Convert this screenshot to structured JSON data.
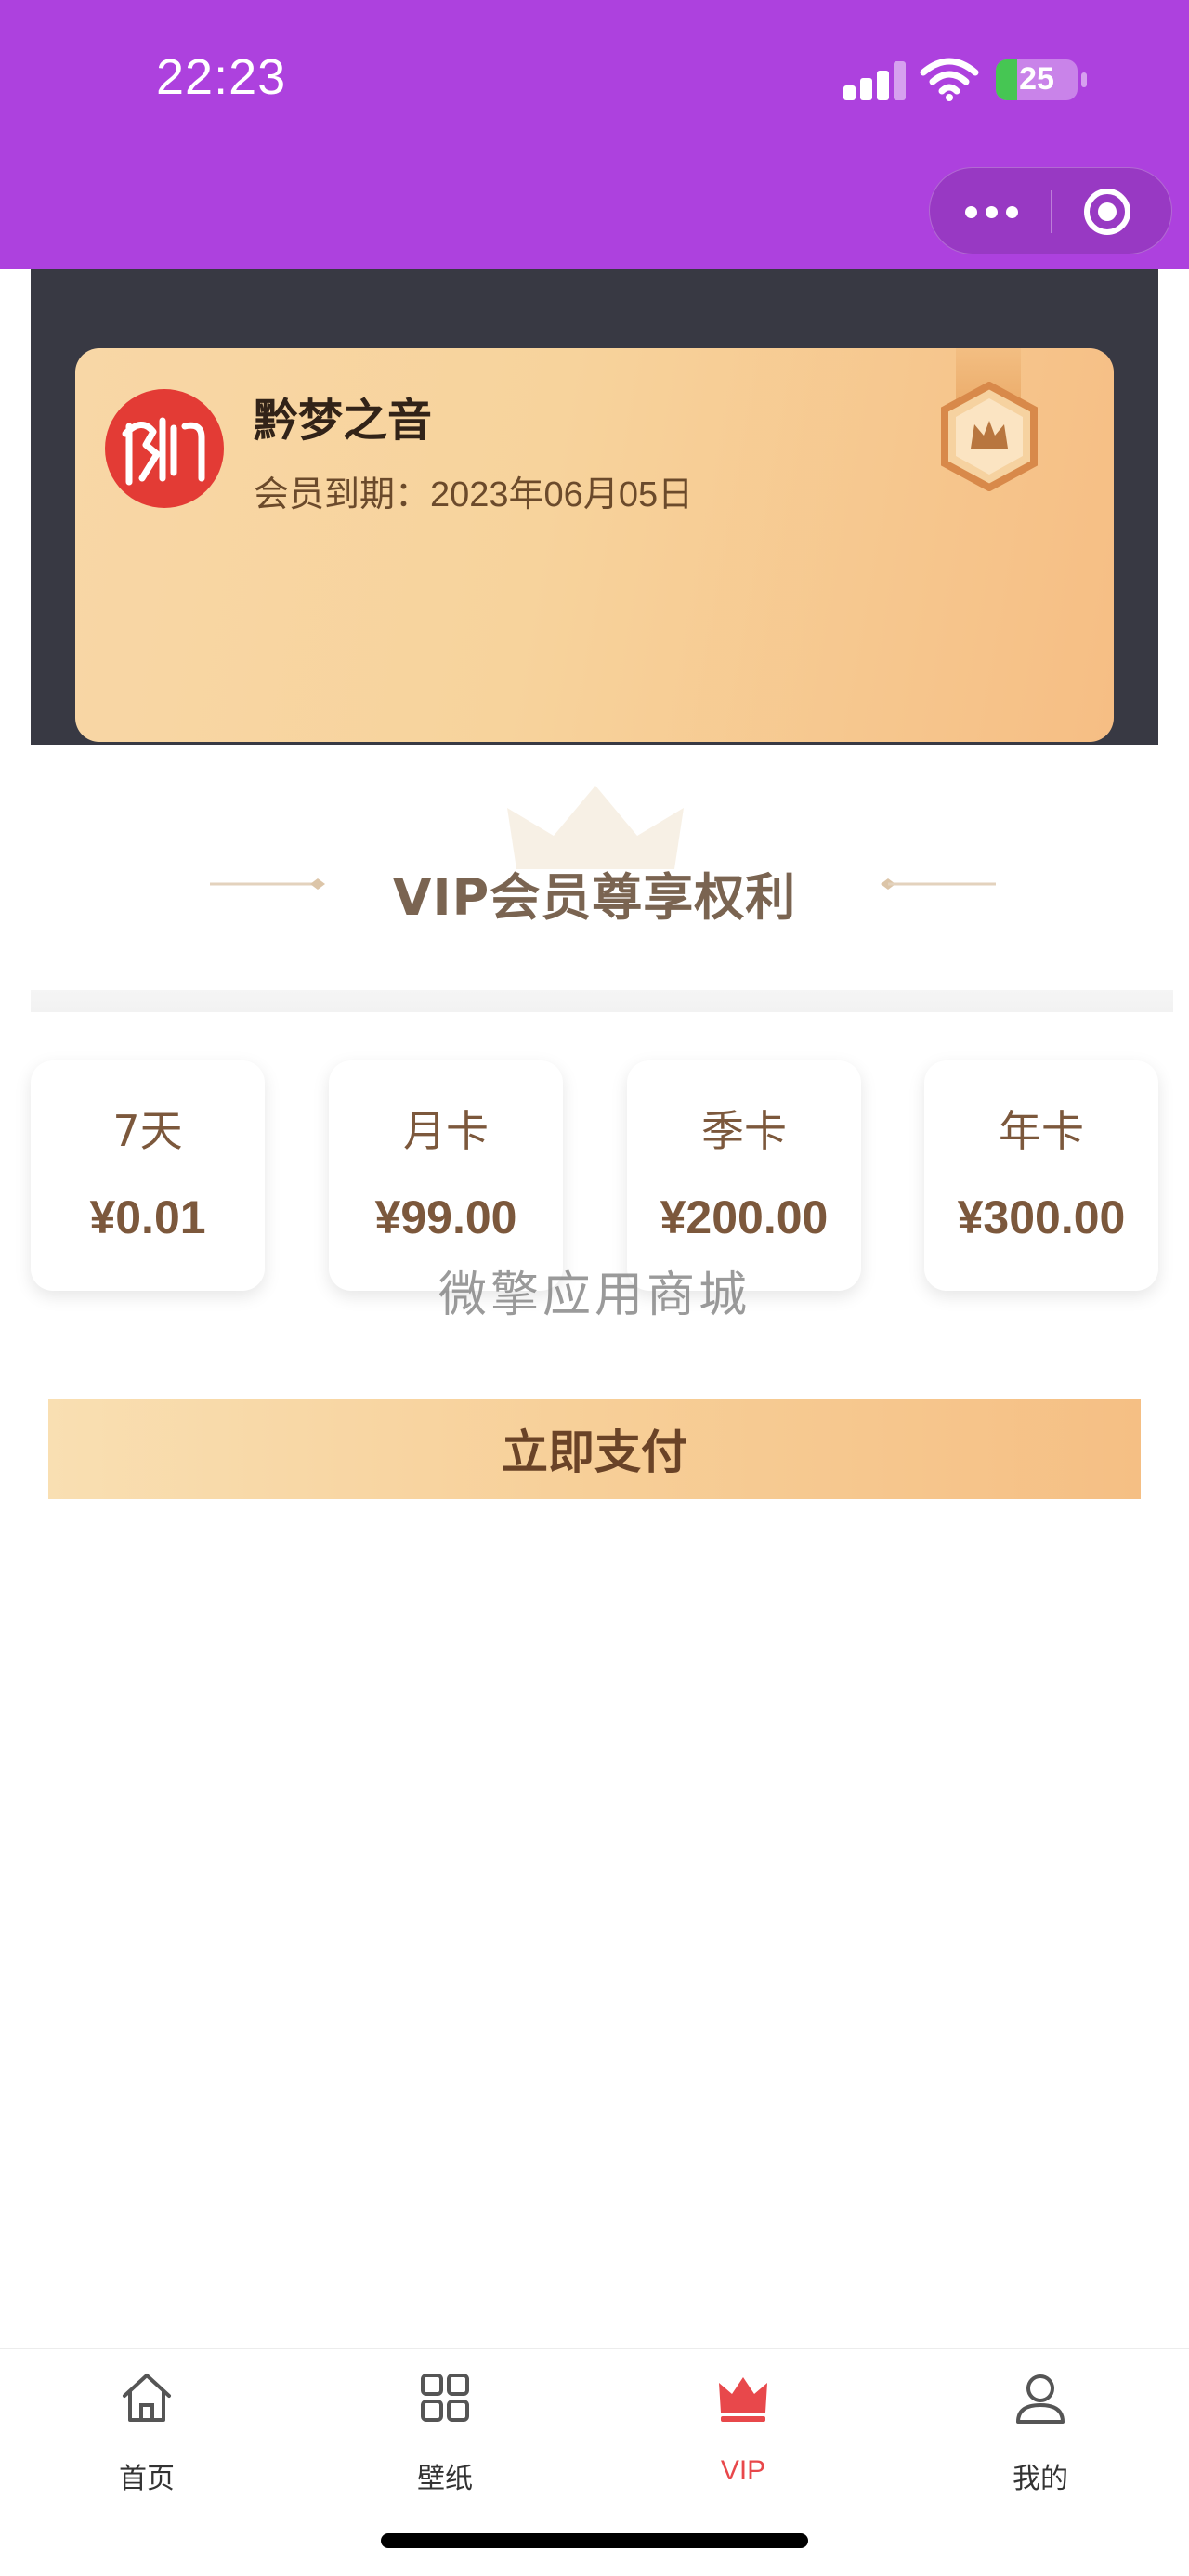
{
  "status_bar": {
    "time": "22:23",
    "battery": "25"
  },
  "member_card": {
    "name": "黔梦之音",
    "expire_label": "会员到期：",
    "expire_date": "2023年06月05日"
  },
  "vip_section": {
    "title": "VIP会员尊享权利"
  },
  "plans": [
    {
      "name": "7天",
      "price": "¥0.01"
    },
    {
      "name": "月卡",
      "price": "¥99.00"
    },
    {
      "name": "季卡",
      "price": "¥200.00"
    },
    {
      "name": "年卡",
      "price": "¥300.00"
    }
  ],
  "watermark": "微擎应用商城",
  "pay_button": "立即支付",
  "tabbar": {
    "items": [
      {
        "label": "首页",
        "icon": "home-icon"
      },
      {
        "label": "壁纸",
        "icon": "grid-icon"
      },
      {
        "label": "VIP",
        "icon": "crown-icon"
      },
      {
        "label": "我的",
        "icon": "user-icon"
      }
    ],
    "active_index": 2,
    "active_color": "#e8484b"
  },
  "colors": {
    "header": "#ad41de",
    "panel": "#383943",
    "accent_text": "#7c583c"
  }
}
